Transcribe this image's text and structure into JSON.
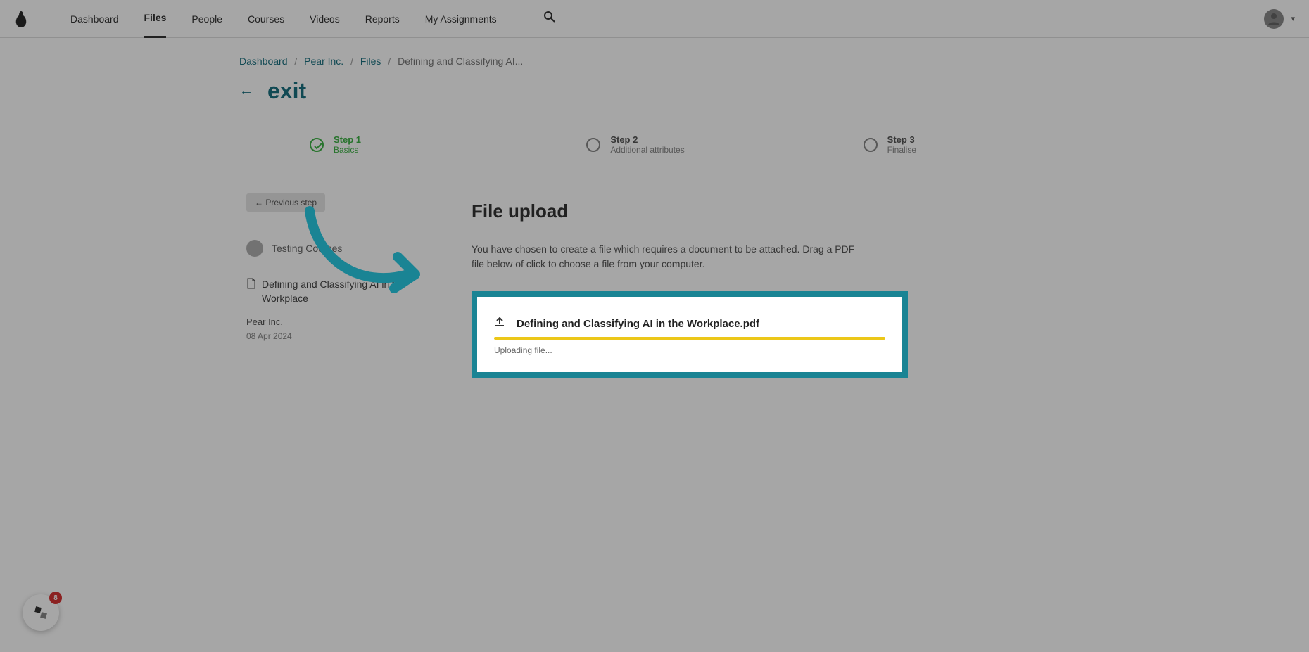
{
  "nav": {
    "items": [
      "Dashboard",
      "Files",
      "People",
      "Courses",
      "Videos",
      "Reports",
      "My Assignments"
    ],
    "activeIndex": 1
  },
  "breadcrumb": {
    "items": [
      "Dashboard",
      "Pear Inc.",
      "Files"
    ],
    "current": "Defining and Classifying AI..."
  },
  "exit": {
    "label": "exit"
  },
  "stepper": {
    "steps": [
      {
        "num": "Step 1",
        "label": "Basics",
        "active": true
      },
      {
        "num": "Step 2",
        "label": "Additional attributes",
        "active": false
      },
      {
        "num": "Step 3",
        "label": "Finalise",
        "active": false
      }
    ]
  },
  "sidebar": {
    "prevStep": "← Previous step",
    "ownerName": "Testing Courses",
    "fileTitle": "Defining and Classifying AI in the Workplace",
    "org": "Pear Inc.",
    "date": "08 Apr 2024"
  },
  "upload": {
    "title": "File upload",
    "description": "You have chosen to create a file which requires a document to be attached. Drag a PDF file below of click to choose a file from your computer.",
    "filename": "Defining and Classifying AI in the Workplace.pdf",
    "status": "Uploading file..."
  },
  "chat": {
    "badgeCount": "8"
  }
}
